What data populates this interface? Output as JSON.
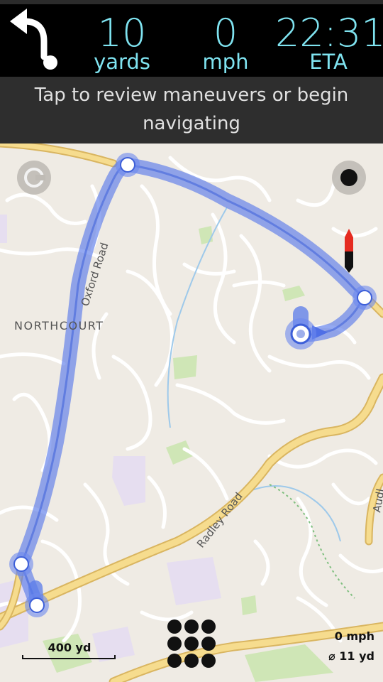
{
  "header": {
    "distance": {
      "value": "10",
      "unit": "yards"
    },
    "speed": {
      "value": "0",
      "unit": "mph"
    },
    "eta": {
      "value": "22:31",
      "unit": "ETA"
    }
  },
  "banner": {
    "text": "Tap to review maneuvers or begin navigating"
  },
  "map": {
    "labels": {
      "area": "NORTHCOURT",
      "road1": "Oxford Road",
      "road2": "Radley Road",
      "road3": "Audl"
    },
    "route_color": "#5a7bea",
    "road_major_color": "#f3d27a"
  },
  "controls": {
    "scale_label": "400 yd",
    "speed_text": "0 mph",
    "accuracy_text": "⌀ 11 yd",
    "icons": [
      "u-turn-left-icon",
      "center-location-icon",
      "gps-status-icon",
      "compass-north-icon",
      "menu-grid-icon"
    ]
  }
}
